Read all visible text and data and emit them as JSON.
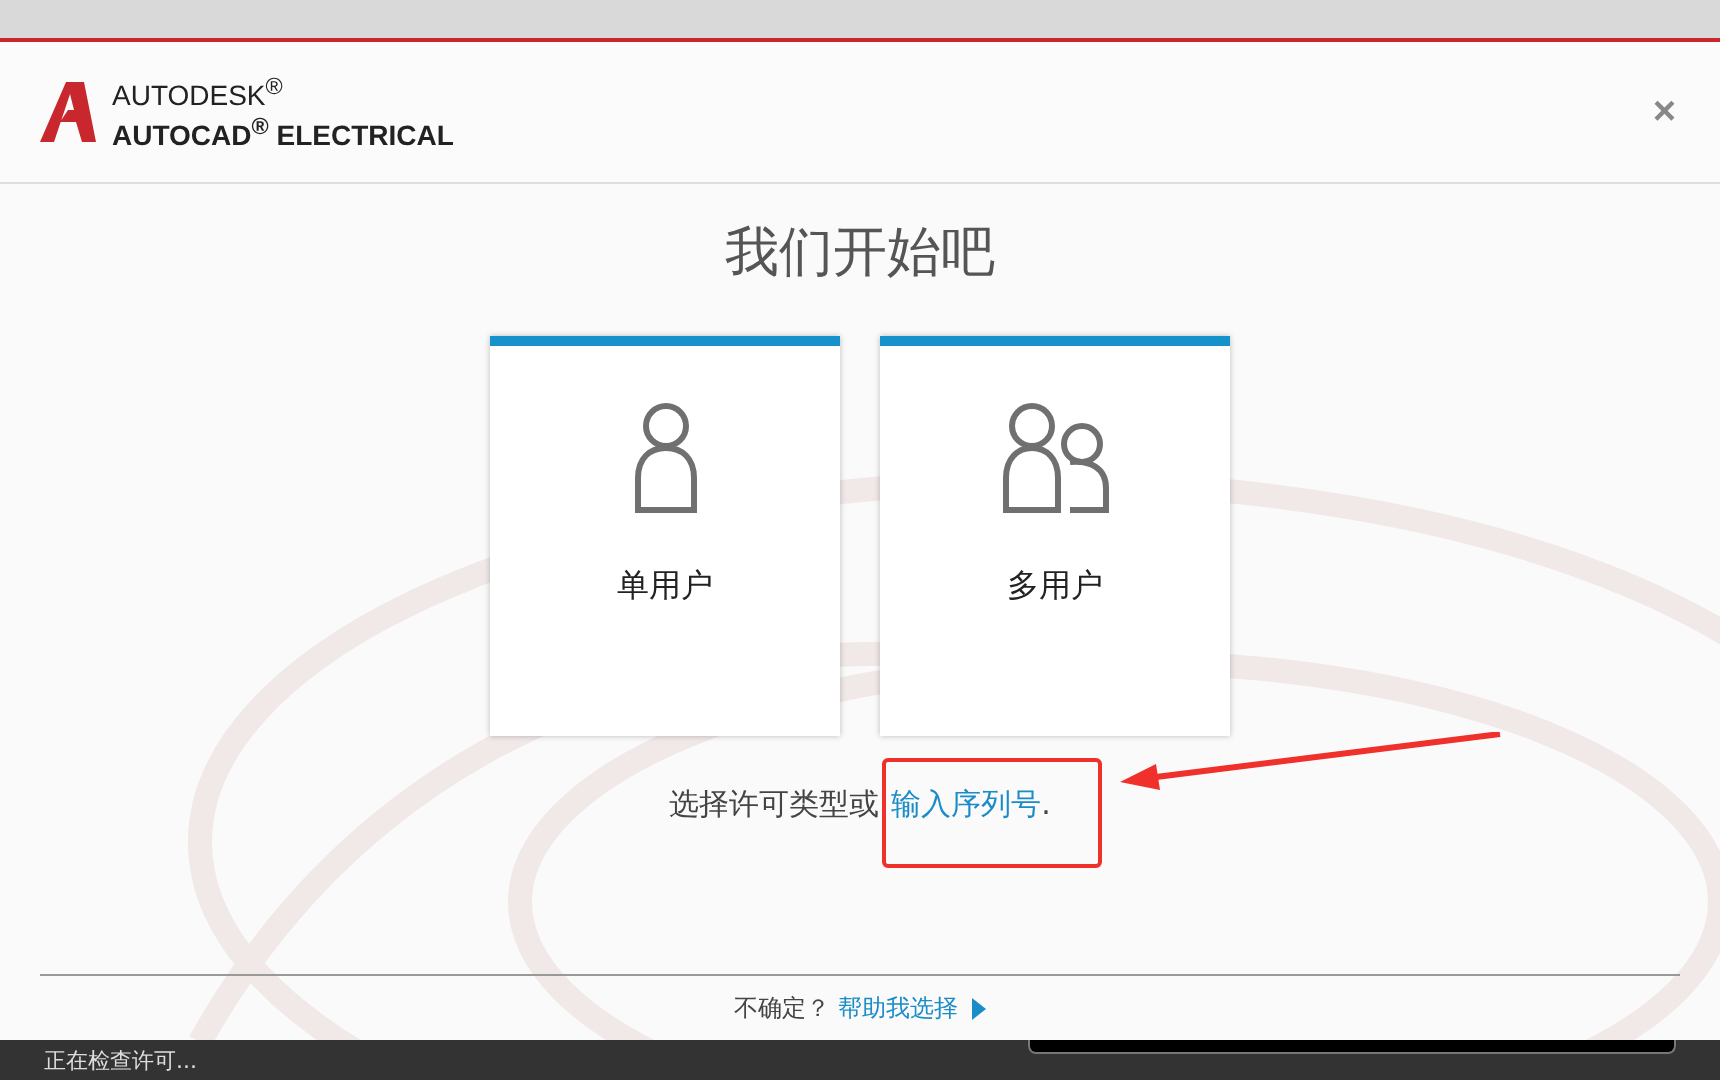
{
  "header": {
    "brand": "AUTODESK$^{®}$",
    "product": "AUTOCAD$^{®}$ ELECTRICAL",
    "close": "×"
  },
  "title": "我们开始吧",
  "options": [
    {
      "label": "单用户",
      "kind": "single"
    },
    {
      "label": "多用户",
      "kind": "multi"
    }
  ],
  "prompt": {
    "text": "选择许可类型或",
    "link": "输入序列号",
    "suffix": "."
  },
  "footer": {
    "question": "不确定？",
    "link": "帮助我选择"
  },
  "status_bar": {
    "text": "正在检查许可..."
  }
}
